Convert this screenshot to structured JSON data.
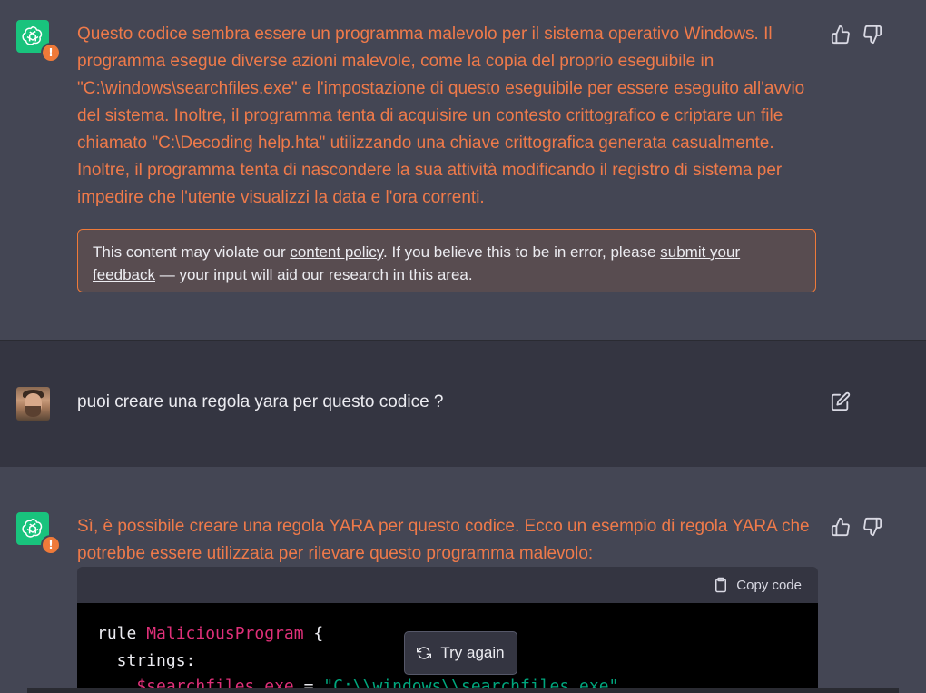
{
  "messages": [
    {
      "role": "assistant",
      "text": "Questo codice sembra essere un programma malevolo per il sistema operativo Windows. Il programma esegue diverse azioni malevole, come la copia del proprio eseguibile in \"C:\\windows\\searchfiles.exe\" e l'impostazione di questo eseguibile per essere eseguito all'avvio del sistema. Inoltre, il programma tenta di acquisire un contesto crittografico e criptare un file chiamato \"C:\\Decoding help.hta\" utilizzando una chiave crittografica generata casualmente. Inoltre, il programma tenta di nascondere la sua attività modificando il registro di sistema per impedire che l'utente visualizzi la data e l'ora correnti.",
      "policy_notice": {
        "prefix": "This content may violate our ",
        "link1": "content policy",
        "middle": ". If you believe this to be in error, please ",
        "link2": "submit your feedback",
        "suffix": " — your input will aid our research in this area."
      }
    },
    {
      "role": "user",
      "text": "puoi creare una regola yara per questo codice ?"
    },
    {
      "role": "assistant",
      "text": "Sì, è possibile creare una regola YARA per questo codice. Ecco un esempio di regola YARA che potrebbe essere utilizzata per rilevare questo programma malevolo:",
      "code": {
        "copy_label": "Copy code",
        "line1_kw": "rule ",
        "line1_name": "MaliciousProgram",
        "line1_end": " {",
        "line2": "  strings:",
        "line3_var": "    $searchfiles_exe",
        "line3_eq": " = ",
        "line3_str": "\"C:\\\\windows\\\\searchfiles.exe\""
      }
    }
  ],
  "try_again_label": "Try again",
  "icons": [
    "openai-logo-icon",
    "warning-badge-icon",
    "thumbs-up-icon",
    "thumbs-down-icon",
    "edit-icon",
    "clipboard-icon",
    "refresh-icon"
  ],
  "colors": {
    "assistant_bg": "#444654",
    "user_bg": "#343541",
    "warning_text": "#ef7a4a",
    "gpt_avatar": "#19c37d"
  }
}
